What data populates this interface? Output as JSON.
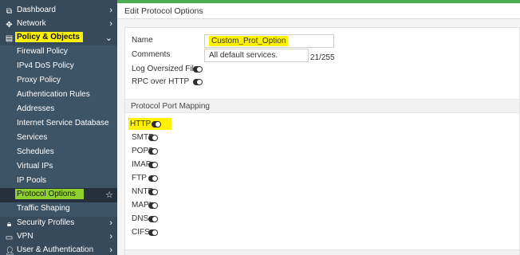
{
  "sidebar": {
    "items": [
      {
        "label": "Dashboard",
        "icon": "dashboard-icon"
      },
      {
        "label": "Network",
        "icon": "network-icon"
      },
      {
        "label": "Policy & Objects",
        "icon": "policy-icon"
      },
      {
        "label": "Firewall Policy"
      },
      {
        "label": "IPv4 DoS Policy"
      },
      {
        "label": "Proxy Policy"
      },
      {
        "label": "Authentication Rules"
      },
      {
        "label": "Addresses"
      },
      {
        "label": "Internet Service Database"
      },
      {
        "label": "Services"
      },
      {
        "label": "Schedules"
      },
      {
        "label": "Virtual IPs"
      },
      {
        "label": "IP Pools"
      },
      {
        "label": "Protocol Options"
      },
      {
        "label": "Traffic Shaping"
      },
      {
        "label": "Security Profiles",
        "icon": "lock-icon"
      },
      {
        "label": "VPN",
        "icon": "vpn-icon"
      },
      {
        "label": "User & Authentication",
        "icon": "user-icon"
      }
    ]
  },
  "page": {
    "title": "Edit Protocol Options"
  },
  "form": {
    "name_label": "Name",
    "name_value": "Custom_Prot_Option",
    "comments_label": "Comments",
    "comments_value": "All default services.",
    "comments_counter": "21/255",
    "log_oversized_label": "Log Oversized Files",
    "rpc_over_http_label": "RPC over HTTP"
  },
  "port_mapping": {
    "section_title": "Protocol Port Mapping",
    "protocols": [
      "HTTP",
      "SMTP",
      "POP3",
      "IMAP",
      "FTP",
      "NNTP",
      "MAPI",
      "DNS",
      "CIFS"
    ]
  },
  "colors": {
    "sidebar_bg": "#374a5b",
    "accent_green": "#4bae4f",
    "highlight_yellow": "#fff200",
    "highlight_green": "#8fcf2e"
  }
}
